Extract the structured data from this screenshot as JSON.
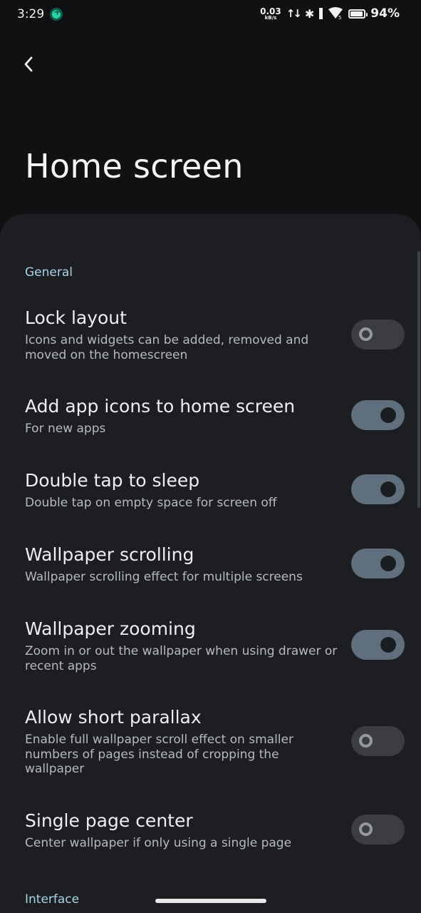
{
  "status_bar": {
    "time": "3:29",
    "net_speed_value": "0.03",
    "net_speed_unit": "kB/s",
    "wifi_badge": "5",
    "battery": "94%",
    "app_icon": "accessibility-icon"
  },
  "header": {
    "back_icon": "chevron-left-icon",
    "title": "Home screen"
  },
  "colors": {
    "background": "#101112",
    "sheet": "#1c1e21",
    "section_header": "#a8d4e6",
    "toggle_on": "#5f6f7e",
    "toggle_off": "#3b3d40"
  },
  "sections": [
    {
      "label": "General",
      "items": [
        {
          "title": "Lock layout",
          "summary": "Icons and widgets can be added, removed and moved on the homescreen",
          "enabled": false
        },
        {
          "title": "Add app icons to home screen",
          "summary": "For new apps",
          "enabled": true
        },
        {
          "title": "Double tap to sleep",
          "summary": "Double tap on empty space for screen off",
          "enabled": true
        },
        {
          "title": "Wallpaper scrolling",
          "summary": "Wallpaper scrolling effect for multiple screens",
          "enabled": true
        },
        {
          "title": "Wallpaper zooming",
          "summary": "Zoom in or out the wallpaper when using drawer or recent apps",
          "enabled": true
        },
        {
          "title": "Allow short parallax",
          "summary": "Enable full wallpaper scroll effect on smaller numbers of pages instead of cropping the wallpaper",
          "enabled": false
        },
        {
          "title": "Single page center",
          "summary": "Center wallpaper if only using a single page",
          "enabled": false
        }
      ]
    },
    {
      "label": "Interface",
      "items": []
    }
  ]
}
